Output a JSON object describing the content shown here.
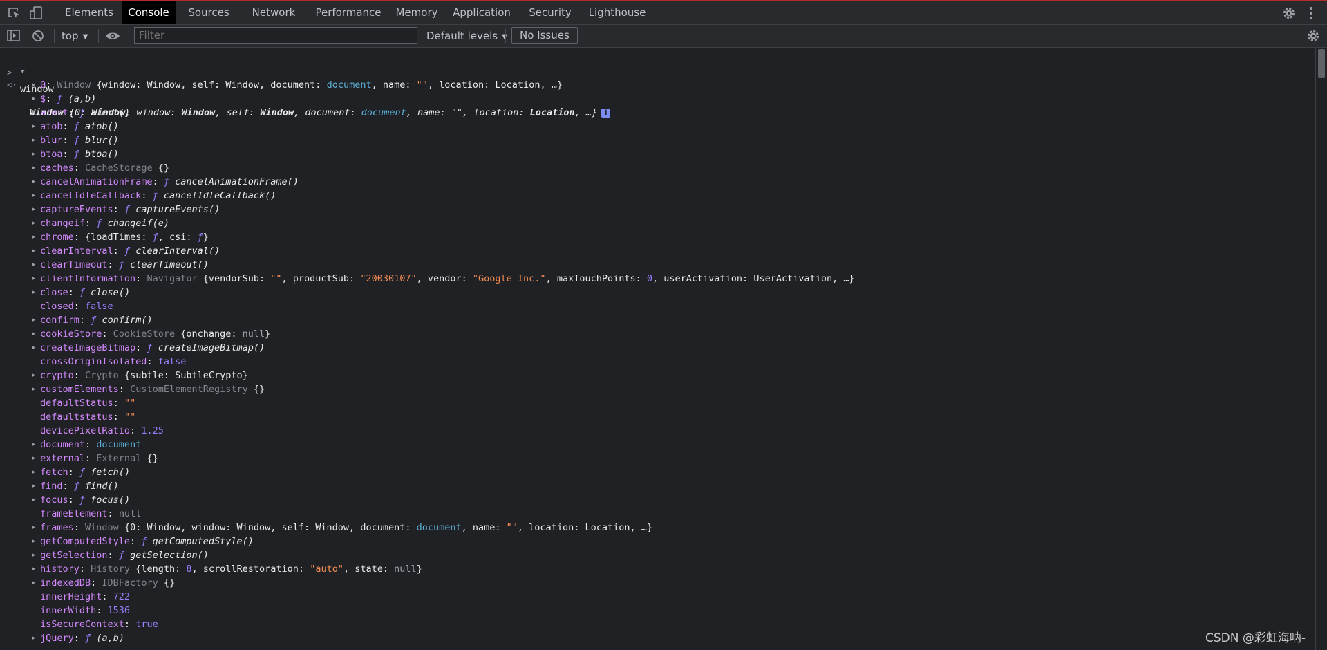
{
  "tabs": [
    "Elements",
    "Console",
    "Sources",
    "Network",
    "Performance",
    "Memory",
    "Application",
    "Security",
    "Lighthouse"
  ],
  "active_tab": "Console",
  "toolbar": {
    "context": "top",
    "filter_placeholder": "Filter",
    "levels": "Default levels",
    "issues": "No Issues"
  },
  "command": "window",
  "result_header": [
    {
      "t": "Window ",
      "c": "hdr-b"
    },
    {
      "t": "{",
      "c": "p"
    },
    {
      "t": "0",
      "c": "p"
    },
    {
      "t": ": ",
      "c": "p"
    },
    {
      "t": "Window",
      "c": "b"
    },
    {
      "t": ", ",
      "c": "p"
    },
    {
      "t": "window",
      "c": "p"
    },
    {
      "t": ": ",
      "c": "p"
    },
    {
      "t": "Window",
      "c": "b"
    },
    {
      "t": ", ",
      "c": "p"
    },
    {
      "t": "self",
      "c": "p"
    },
    {
      "t": ": ",
      "c": "p"
    },
    {
      "t": "Window",
      "c": "b"
    },
    {
      "t": ", ",
      "c": "p"
    },
    {
      "t": "document",
      "c": "p"
    },
    {
      "t": ": ",
      "c": "p"
    },
    {
      "t": "document",
      "c": "doc"
    },
    {
      "t": ", ",
      "c": "p"
    },
    {
      "t": "name",
      "c": "p"
    },
    {
      "t": ": ",
      "c": "p"
    },
    {
      "t": "\"\"",
      "c": "s"
    },
    {
      "t": ", ",
      "c": "p"
    },
    {
      "t": "location",
      "c": "p"
    },
    {
      "t": ": ",
      "c": "p"
    },
    {
      "t": "Location",
      "c": "b"
    },
    {
      "t": ", …}",
      "c": "p"
    }
  ],
  "props": [
    {
      "e": 1,
      "seg": [
        [
          "0",
          "k"
        ],
        [
          ": ",
          "p"
        ],
        [
          "Window ",
          "cn"
        ],
        [
          "{window: Window, self: Window, document: ",
          "p"
        ],
        [
          "document",
          "doc"
        ],
        [
          ", name: ",
          "p"
        ],
        [
          "\"\"",
          "s"
        ],
        [
          ", location: Location, …}",
          "p"
        ]
      ]
    },
    {
      "e": 1,
      "seg": [
        [
          "$",
          "k"
        ],
        [
          ": ",
          "p"
        ],
        [
          "ƒ ",
          "fsym"
        ],
        [
          "(a,b)",
          "fn"
        ]
      ]
    },
    {
      "e": 1,
      "seg": [
        [
          "alert",
          "k"
        ],
        [
          ": ",
          "p"
        ],
        [
          "ƒ ",
          "fsym"
        ],
        [
          "alert()",
          "fn"
        ]
      ]
    },
    {
      "e": 1,
      "seg": [
        [
          "atob",
          "k"
        ],
        [
          ": ",
          "p"
        ],
        [
          "ƒ ",
          "fsym"
        ],
        [
          "atob()",
          "fn"
        ]
      ]
    },
    {
      "e": 1,
      "seg": [
        [
          "blur",
          "k"
        ],
        [
          ": ",
          "p"
        ],
        [
          "ƒ ",
          "fsym"
        ],
        [
          "blur()",
          "fn"
        ]
      ]
    },
    {
      "e": 1,
      "seg": [
        [
          "btoa",
          "k"
        ],
        [
          ": ",
          "p"
        ],
        [
          "ƒ ",
          "fsym"
        ],
        [
          "btoa()",
          "fn"
        ]
      ]
    },
    {
      "e": 1,
      "seg": [
        [
          "caches",
          "k"
        ],
        [
          ": ",
          "p"
        ],
        [
          "CacheStorage ",
          "cn"
        ],
        [
          "{}",
          "p"
        ]
      ]
    },
    {
      "e": 1,
      "seg": [
        [
          "cancelAnimationFrame",
          "k"
        ],
        [
          ": ",
          "p"
        ],
        [
          "ƒ ",
          "fsym"
        ],
        [
          "cancelAnimationFrame()",
          "fn"
        ]
      ]
    },
    {
      "e": 1,
      "seg": [
        [
          "cancelIdleCallback",
          "k"
        ],
        [
          ": ",
          "p"
        ],
        [
          "ƒ ",
          "fsym"
        ],
        [
          "cancelIdleCallback()",
          "fn"
        ]
      ]
    },
    {
      "e": 1,
      "seg": [
        [
          "captureEvents",
          "k"
        ],
        [
          ": ",
          "p"
        ],
        [
          "ƒ ",
          "fsym"
        ],
        [
          "captureEvents()",
          "fn"
        ]
      ]
    },
    {
      "e": 1,
      "seg": [
        [
          "changeif",
          "k"
        ],
        [
          ": ",
          "p"
        ],
        [
          "ƒ ",
          "fsym"
        ],
        [
          "changeif(e)",
          "fn"
        ]
      ]
    },
    {
      "e": 1,
      "seg": [
        [
          "chrome",
          "k"
        ],
        [
          ": ",
          "p"
        ],
        [
          "{loadTimes: ",
          "p"
        ],
        [
          "ƒ",
          "fsym"
        ],
        [
          ", csi: ",
          "p"
        ],
        [
          "ƒ",
          "fsym"
        ],
        [
          "}",
          "p"
        ]
      ]
    },
    {
      "e": 1,
      "seg": [
        [
          "clearInterval",
          "k"
        ],
        [
          ": ",
          "p"
        ],
        [
          "ƒ ",
          "fsym"
        ],
        [
          "clearInterval()",
          "fn"
        ]
      ]
    },
    {
      "e": 1,
      "seg": [
        [
          "clearTimeout",
          "k"
        ],
        [
          ": ",
          "p"
        ],
        [
          "ƒ ",
          "fsym"
        ],
        [
          "clearTimeout()",
          "fn"
        ]
      ]
    },
    {
      "e": 1,
      "seg": [
        [
          "clientInformation",
          "k"
        ],
        [
          ": ",
          "p"
        ],
        [
          "Navigator ",
          "cn"
        ],
        [
          "{vendorSub: ",
          "p"
        ],
        [
          "\"\"",
          "s"
        ],
        [
          ", productSub: ",
          "p"
        ],
        [
          "\"20030107\"",
          "s"
        ],
        [
          ", vendor: ",
          "p"
        ],
        [
          "\"Google Inc.\"",
          "s"
        ],
        [
          ", maxTouchPoints: ",
          "p"
        ],
        [
          "0",
          "n"
        ],
        [
          ", userActivation: UserActivation, …}",
          "p"
        ]
      ]
    },
    {
      "e": 1,
      "seg": [
        [
          "close",
          "k"
        ],
        [
          ": ",
          "p"
        ],
        [
          "ƒ ",
          "fsym"
        ],
        [
          "close()",
          "fn"
        ]
      ]
    },
    {
      "e": 0,
      "seg": [
        [
          "closed",
          "k"
        ],
        [
          ": ",
          "p"
        ],
        [
          "false",
          "kw"
        ]
      ]
    },
    {
      "e": 1,
      "seg": [
        [
          "confirm",
          "k"
        ],
        [
          ": ",
          "p"
        ],
        [
          "ƒ ",
          "fsym"
        ],
        [
          "confirm()",
          "fn"
        ]
      ]
    },
    {
      "e": 1,
      "seg": [
        [
          "cookieStore",
          "k"
        ],
        [
          ": ",
          "p"
        ],
        [
          "CookieStore ",
          "cn"
        ],
        [
          "{onchange: ",
          "p"
        ],
        [
          "null",
          "nul"
        ],
        [
          "}",
          "p"
        ]
      ]
    },
    {
      "e": 1,
      "seg": [
        [
          "createImageBitmap",
          "k"
        ],
        [
          ": ",
          "p"
        ],
        [
          "ƒ ",
          "fsym"
        ],
        [
          "createImageBitmap()",
          "fn"
        ]
      ]
    },
    {
      "e": 0,
      "seg": [
        [
          "crossOriginIsolated",
          "k"
        ],
        [
          ": ",
          "p"
        ],
        [
          "false",
          "kw"
        ]
      ]
    },
    {
      "e": 1,
      "seg": [
        [
          "crypto",
          "k"
        ],
        [
          ": ",
          "p"
        ],
        [
          "Crypto ",
          "cn"
        ],
        [
          "{subtle: SubtleCrypto}",
          "p"
        ]
      ]
    },
    {
      "e": 1,
      "seg": [
        [
          "customElements",
          "k"
        ],
        [
          ": ",
          "p"
        ],
        [
          "CustomElementRegistry ",
          "cn"
        ],
        [
          "{}",
          "p"
        ]
      ]
    },
    {
      "e": 0,
      "seg": [
        [
          "defaultStatus",
          "k"
        ],
        [
          ": ",
          "p"
        ],
        [
          "\"\"",
          "s"
        ]
      ]
    },
    {
      "e": 0,
      "seg": [
        [
          "defaultstatus",
          "k"
        ],
        [
          ": ",
          "p"
        ],
        [
          "\"\"",
          "s"
        ]
      ]
    },
    {
      "e": 0,
      "seg": [
        [
          "devicePixelRatio",
          "k"
        ],
        [
          ": ",
          "p"
        ],
        [
          "1.25",
          "n"
        ]
      ]
    },
    {
      "e": 1,
      "seg": [
        [
          "document",
          "k"
        ],
        [
          ": ",
          "p"
        ],
        [
          "document",
          "doc"
        ]
      ]
    },
    {
      "e": 1,
      "seg": [
        [
          "external",
          "k"
        ],
        [
          ": ",
          "p"
        ],
        [
          "External ",
          "cn"
        ],
        [
          "{}",
          "p"
        ]
      ]
    },
    {
      "e": 1,
      "seg": [
        [
          "fetch",
          "k"
        ],
        [
          ": ",
          "p"
        ],
        [
          "ƒ ",
          "fsym"
        ],
        [
          "fetch()",
          "fn"
        ]
      ]
    },
    {
      "e": 1,
      "seg": [
        [
          "find",
          "k"
        ],
        [
          ": ",
          "p"
        ],
        [
          "ƒ ",
          "fsym"
        ],
        [
          "find()",
          "fn"
        ]
      ]
    },
    {
      "e": 1,
      "seg": [
        [
          "focus",
          "k"
        ],
        [
          ": ",
          "p"
        ],
        [
          "ƒ ",
          "fsym"
        ],
        [
          "focus()",
          "fn"
        ]
      ]
    },
    {
      "e": 0,
      "seg": [
        [
          "frameElement",
          "k"
        ],
        [
          ": ",
          "p"
        ],
        [
          "null",
          "nul"
        ]
      ]
    },
    {
      "e": 1,
      "seg": [
        [
          "frames",
          "k"
        ],
        [
          ": ",
          "p"
        ],
        [
          "Window ",
          "cn"
        ],
        [
          "{0: Window, window: Window, self: Window, document: ",
          "p"
        ],
        [
          "document",
          "doc"
        ],
        [
          ", name: ",
          "p"
        ],
        [
          "\"\"",
          "s"
        ],
        [
          ", location: Location, …}",
          "p"
        ]
      ]
    },
    {
      "e": 1,
      "seg": [
        [
          "getComputedStyle",
          "k"
        ],
        [
          ": ",
          "p"
        ],
        [
          "ƒ ",
          "fsym"
        ],
        [
          "getComputedStyle()",
          "fn"
        ]
      ]
    },
    {
      "e": 1,
      "seg": [
        [
          "getSelection",
          "k"
        ],
        [
          ": ",
          "p"
        ],
        [
          "ƒ ",
          "fsym"
        ],
        [
          "getSelection()",
          "fn"
        ]
      ]
    },
    {
      "e": 1,
      "seg": [
        [
          "history",
          "k"
        ],
        [
          ": ",
          "p"
        ],
        [
          "History ",
          "cn"
        ],
        [
          "{length: ",
          "p"
        ],
        [
          "8",
          "n"
        ],
        [
          ", scrollRestoration: ",
          "p"
        ],
        [
          "\"auto\"",
          "s"
        ],
        [
          ", state: ",
          "p"
        ],
        [
          "null",
          "nul"
        ],
        [
          "}",
          "p"
        ]
      ]
    },
    {
      "e": 1,
      "seg": [
        [
          "indexedDB",
          "k"
        ],
        [
          ": ",
          "p"
        ],
        [
          "IDBFactory ",
          "cn"
        ],
        [
          "{}",
          "p"
        ]
      ]
    },
    {
      "e": 0,
      "seg": [
        [
          "innerHeight",
          "k"
        ],
        [
          ": ",
          "p"
        ],
        [
          "722",
          "n"
        ]
      ]
    },
    {
      "e": 0,
      "seg": [
        [
          "innerWidth",
          "k"
        ],
        [
          ": ",
          "p"
        ],
        [
          "1536",
          "n"
        ]
      ]
    },
    {
      "e": 0,
      "seg": [
        [
          "isSecureContext",
          "k"
        ],
        [
          ": ",
          "p"
        ],
        [
          "true",
          "kw"
        ]
      ]
    },
    {
      "e": 1,
      "seg": [
        [
          "jQuery",
          "k"
        ],
        [
          ": ",
          "p"
        ],
        [
          "ƒ ",
          "fsym"
        ],
        [
          "(a,b)",
          "fn"
        ]
      ]
    }
  ],
  "watermark": "CSDN @彩虹海呐-",
  "colors": {
    "key": "#d38aff",
    "string": "#f28b54",
    "number": "#9980ff",
    "node": "#5db0d7",
    "class_name": "#80868b",
    "accent_bar": "#b42b2b"
  }
}
